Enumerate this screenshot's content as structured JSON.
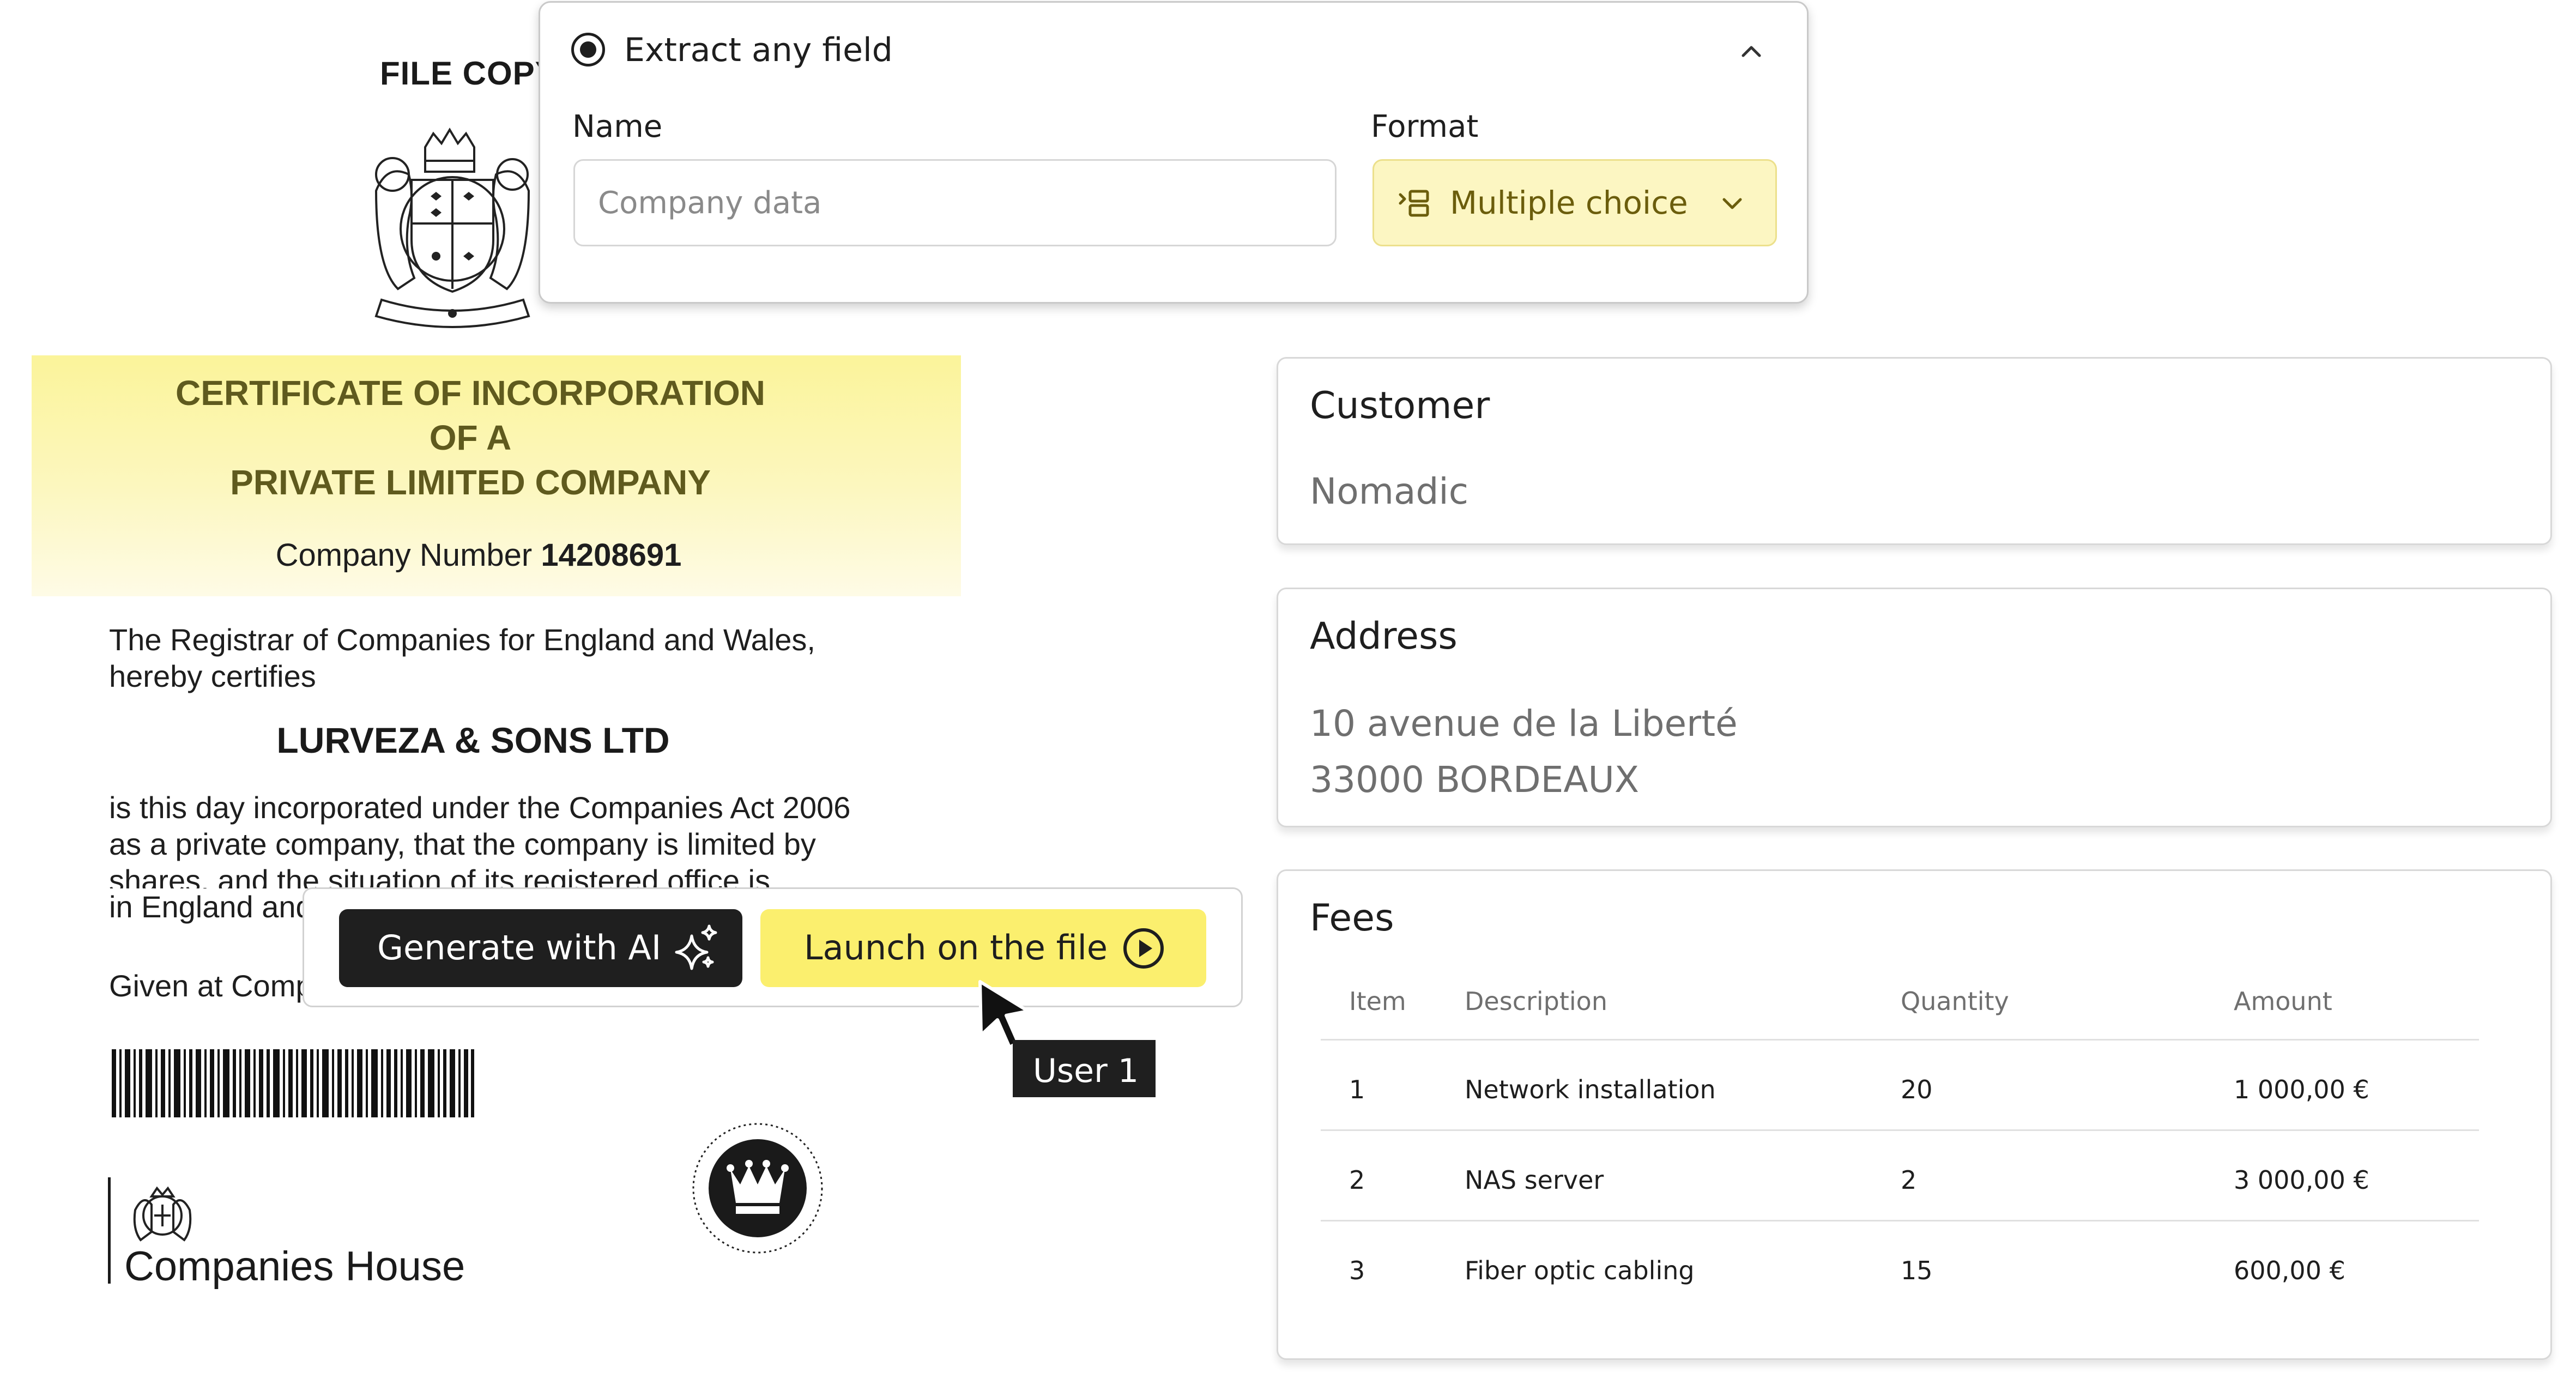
{
  "document": {
    "file_copy": "FILE COPY",
    "certificate_title_lines": [
      "CERTIFICATE OF INCORPORATION",
      "OF A",
      "PRIVATE LIMITED COMPANY"
    ],
    "company_number_label": "Company Number",
    "company_number": "14208691",
    "registrar_text": "The Registrar of Companies for England and Wales, hereby certifies",
    "company_name": "LURVEZA & SONS LTD",
    "incorporation_lines": [
      "is this day incorporated under the Companies Act 2006",
      "as a private company, that the company is limited by",
      "shares, and the situation of its registered office is",
      "in England and Wales"
    ],
    "given_at": "Given at Companies House",
    "issuer": "Companies House"
  },
  "extract_panel": {
    "title": "Extract any field",
    "name_label": "Name",
    "name_placeholder": "Company data",
    "format_label": "Format",
    "format_value": "Multiple choice",
    "colors": {
      "format_bg": "#fcf6c2",
      "format_text": "#6b5d0c"
    }
  },
  "action_bar": {
    "generate_label": "Generate with AI",
    "launch_label": "Launch on the file",
    "cursor_user": "User 1",
    "colors": {
      "generate_bg": "#1f1f1f",
      "launch_bg": "#fbef6e"
    }
  },
  "cards": {
    "customer": {
      "title": "Customer",
      "value": "Nomadic"
    },
    "address": {
      "title": "Address",
      "lines": [
        "10 avenue de la Liberté",
        "33000 BORDEAUX"
      ]
    },
    "fees": {
      "title": "Fees",
      "columns": [
        "Item",
        "Description",
        "Quantity",
        "Amount"
      ],
      "rows": [
        {
          "item": "1",
          "description": "Network installation",
          "quantity": "20",
          "amount": "1 000,00 €"
        },
        {
          "item": "2",
          "description": "NAS server",
          "quantity": "2",
          "amount": "3 000,00 €"
        },
        {
          "item": "3",
          "description": "Fiber optic cabling",
          "quantity": "15",
          "amount": "600,00 €"
        }
      ]
    }
  }
}
